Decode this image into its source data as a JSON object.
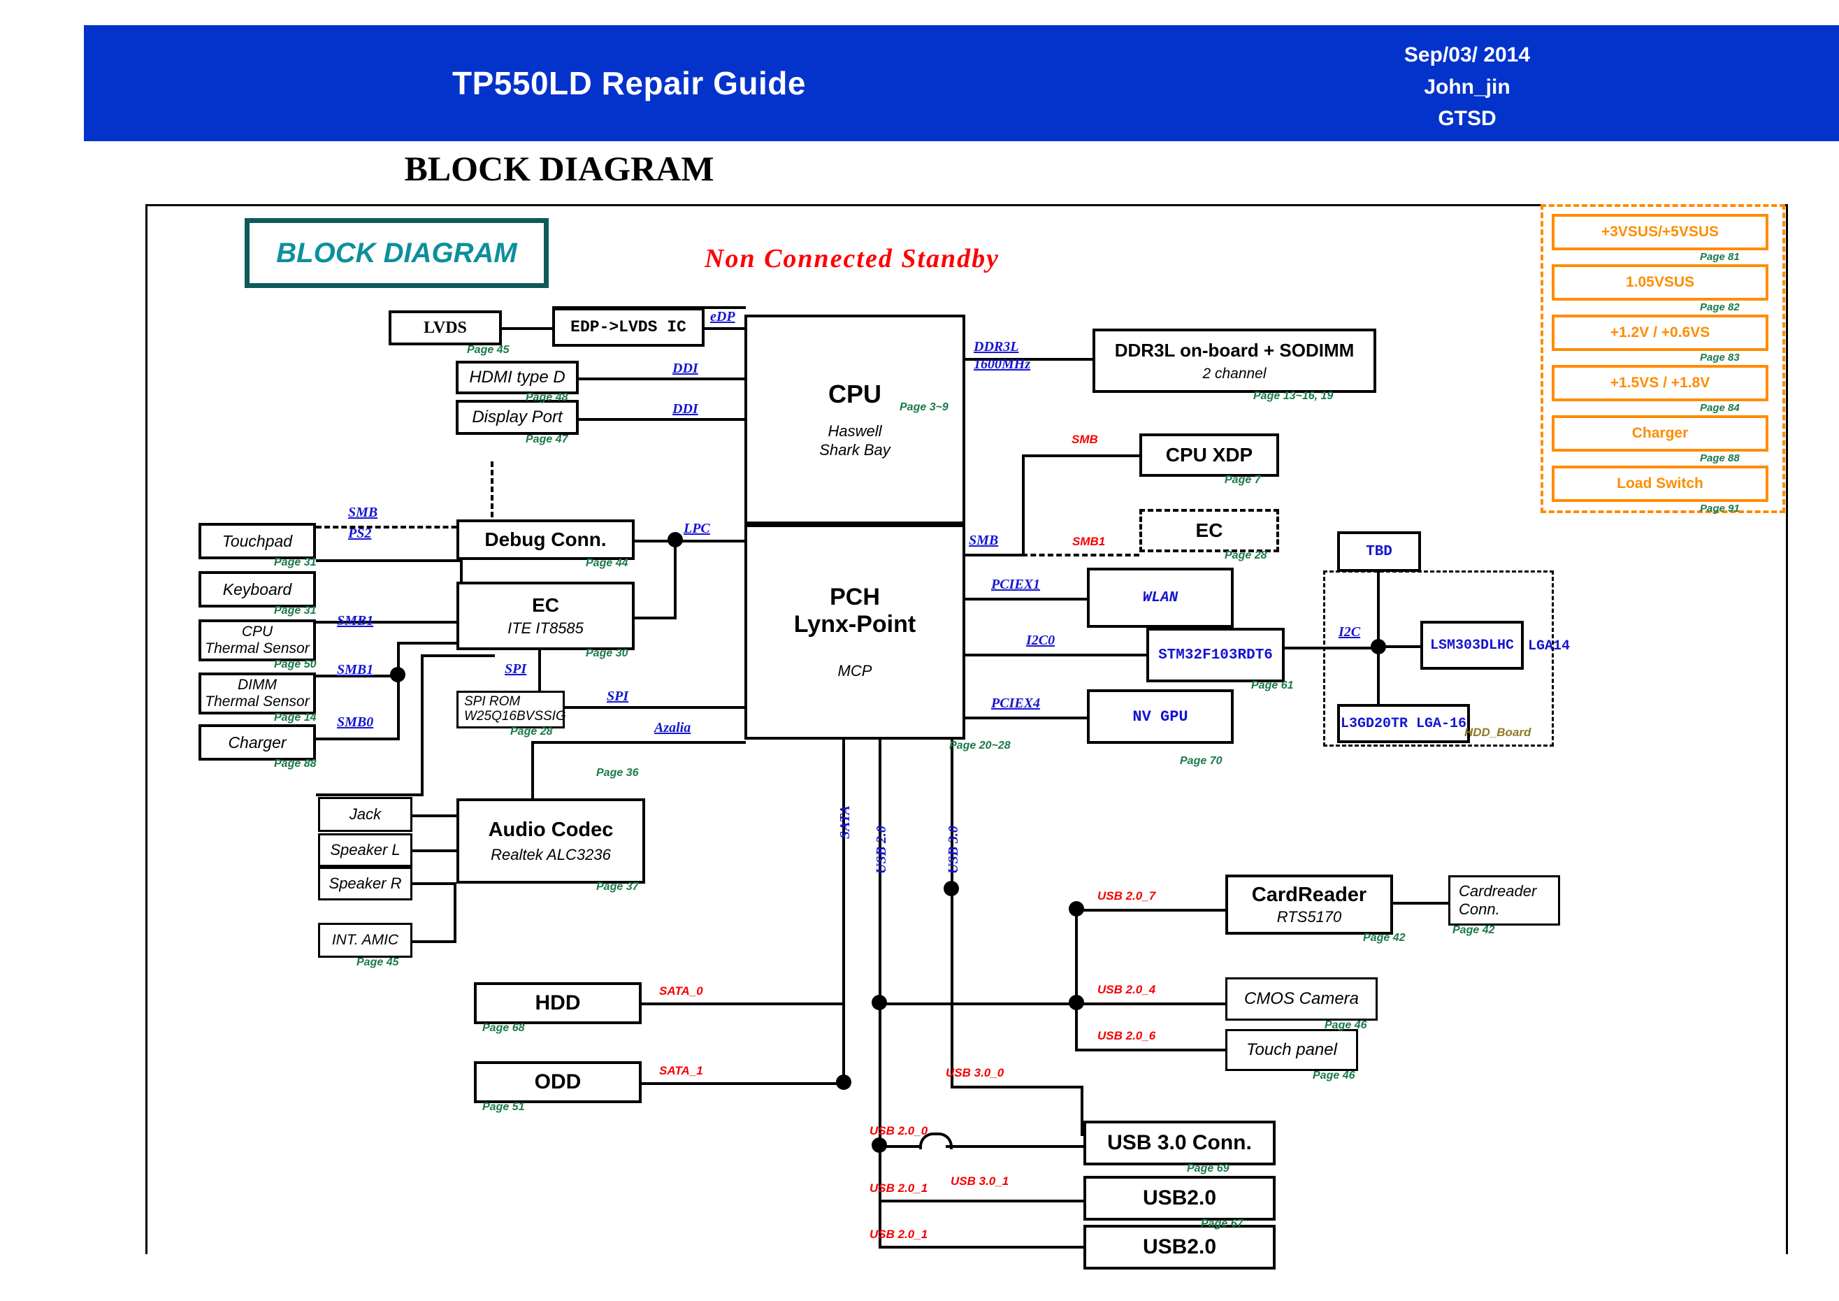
{
  "header": {
    "title": "TP550LD Repair Guide",
    "date": "Sep/03/ 2014",
    "author": "John_jin",
    "org": "GTSD",
    "accent_color": "#0433cc"
  },
  "page_title": "BLOCK DIAGRAM",
  "badge": {
    "label": "BLOCK DIAGRAM",
    "color": "#0d8f9c"
  },
  "note": {
    "text": "Non Connected Standby",
    "color": "#ff0000"
  },
  "blocks": {
    "lvds": {
      "l1": "LVDS",
      "page": "Page 45"
    },
    "edp_lvds_ic": {
      "l1": "EDP->LVDS IC",
      "page": ""
    },
    "hdmi": {
      "l1": "HDMI type D",
      "page": "Page 48"
    },
    "dp": {
      "l1": "Display Port",
      "page": "Page 47"
    },
    "cpu": {
      "l1": "CPU",
      "l2": "Haswell",
      "l3": "Shark Bay",
      "page": "Page 3~9"
    },
    "ddr": {
      "l1": "DDR3L on-board + SODIMM",
      "l2": "2 channel",
      "page": "Page 13~16, 19"
    },
    "cpu_xdp": {
      "l1": "CPU XDP",
      "page": "Page 7"
    },
    "ec_dashed": {
      "l1": "EC",
      "page": "Page 28"
    },
    "touchpad": {
      "l1": "Touchpad",
      "page": "Page 31"
    },
    "keyboard": {
      "l1": "Keyboard",
      "page": "Page 31"
    },
    "cpu_therm": {
      "l1": "CPU",
      "l2": "Thermal Sensor",
      "page": "Page 50"
    },
    "dimm_therm": {
      "l1": "DIMM",
      "l2": "Thermal Sensor",
      "page": "Page 14"
    },
    "charger": {
      "l1": "Charger",
      "page": "Page 88"
    },
    "debug_conn": {
      "l1": "Debug Conn.",
      "page": "Page 44"
    },
    "ec": {
      "l1": "EC",
      "l2": "ITE IT8585",
      "page": "Page 30"
    },
    "spi_rom": {
      "l1": "SPI ROM",
      "l2": "W25Q16BVSSIG",
      "page": "Page 28"
    },
    "pch": {
      "l1": "PCH",
      "l2": "Lynx-Point",
      "l3": "MCP",
      "page": "Page 20~28"
    },
    "wlan": {
      "l1": "WLAN",
      "page": ""
    },
    "stm32": {
      "l1": "STM32F103RDT6",
      "page": "Page 61"
    },
    "nv_gpu": {
      "l1": "NV GPU",
      "page": "Page 70"
    },
    "tbd": {
      "l1": "TBD",
      "page": ""
    },
    "lsm303": {
      "l1": "LSM303DLHC",
      "suffix": "LGA14",
      "page": ""
    },
    "l3gd20": {
      "l1": "L3GD20TR LGA-16",
      "page": ""
    },
    "hdd_board": {
      "label": "HDD_Board"
    },
    "jack": {
      "l1": "Jack",
      "page": ""
    },
    "speaker_l": {
      "l1": "Speaker L",
      "page": ""
    },
    "speaker_r": {
      "l1": "Speaker R",
      "page": ""
    },
    "int_amic": {
      "l1": "INT. AMIC",
      "page": "Page 45"
    },
    "audio_codec": {
      "l1": "Audio Codec",
      "l2": "Realtek ALC3236",
      "page": "Page 37"
    },
    "hdd": {
      "l1": "HDD",
      "page": "Page 68"
    },
    "odd": {
      "l1": "ODD",
      "page": "Page 51"
    },
    "cardreader": {
      "l1": "CardReader",
      "l2": "RTS5170",
      "page": "Page 42"
    },
    "cardreader_conn": {
      "l1": "Cardreader",
      "l2": "Conn.",
      "page": "Page 42"
    },
    "cmos_camera": {
      "l1": "CMOS Camera",
      "page": "Page 46"
    },
    "touch_panel": {
      "l1": "Touch panel",
      "page": "Page 46"
    },
    "usb30_conn": {
      "l1": "USB 3.0 Conn.",
      "page": "Page 69"
    },
    "usb20_a": {
      "l1": "USB2.0",
      "page": "Page 67"
    },
    "usb20_b": {
      "l1": "USB2.0",
      "page": ""
    }
  },
  "signals": {
    "edp": "eDP",
    "ddi1": "DDI",
    "ddi2": "DDI",
    "ddr3l": "DDR3L",
    "ddr_speed": "1600MHz",
    "smb_xdp": "SMB",
    "smb_pch": "SMB",
    "smb1_ec": "SMB1",
    "smb_touchpad": "SMB",
    "ps2": "PS2",
    "smb1_cpu_therm": "SMB1",
    "smb1_dimm_therm": "SMB1",
    "smb0_charger": "SMB0",
    "lpc": "LPC",
    "spi_ec": "SPI",
    "spi_pch": "SPI",
    "azalia": "Azalia",
    "pciex1": "PCIEX1",
    "i2c0": "I2C0",
    "pciex4": "PCIEX4",
    "i2c": "I2C",
    "sata_bus": "SATA",
    "usb20_bus": "USB 2.0",
    "usb30_bus": "USB 3.0",
    "sata_0": "SATA_0",
    "sata_1": "SATA_1",
    "usb207": "USB 2.0_7",
    "usb204": "USB 2.0_4",
    "usb206": "USB 2.0_6",
    "usb300": "USB 3.0_0",
    "usb200": "USB 2.0_0",
    "usb301": "USB 3.0_1",
    "usb201a": "USB 2.0_1",
    "usb201b": "USB 2.0_1"
  },
  "power_rails": [
    {
      "label": "+3VSUS/+5VSUS",
      "page": "Page 81"
    },
    {
      "label": "1.05VSUS",
      "page": "Page 82"
    },
    {
      "label": "+1.2V / +0.6VS",
      "page": "Page 83"
    },
    {
      "label": "+1.5VS / +1.8V",
      "page": "Page 84"
    },
    {
      "label": "Charger",
      "page": "Page 88"
    },
    {
      "label": "Load Switch",
      "page": "Page 91"
    }
  ],
  "colors": {
    "header_blue": "#0433cc",
    "signal_blue": "#1414d2",
    "signal_red": "#f50000",
    "page_green": "#1a7a4a",
    "power_orange": "#ff8c00",
    "badge_teal": "#0d8f9c"
  }
}
